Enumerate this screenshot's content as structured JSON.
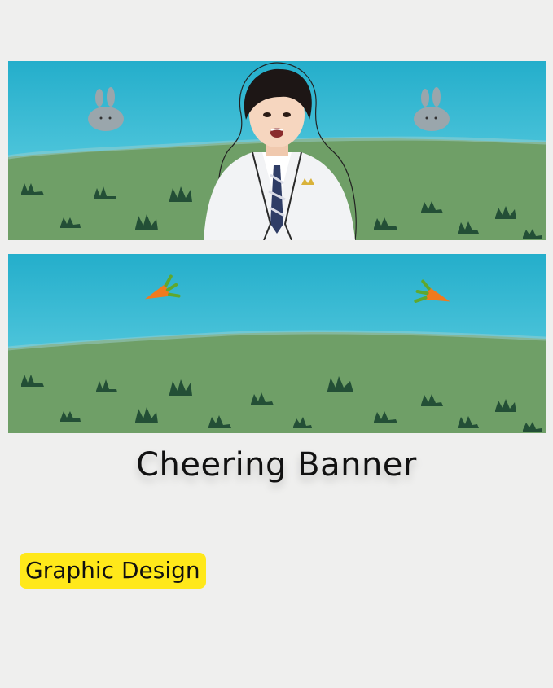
{
  "title": "Cheering Banner",
  "tag": "Graphic Design",
  "colors": {
    "page_bg": "#efefee",
    "sky": "#2fb6d2",
    "grass": "#6f9f67",
    "grass_tuft": "#234f36",
    "tag_bg": "#ffe81a"
  },
  "banners": [
    {
      "decorations": [
        "bunny-icon",
        "bunny-icon"
      ],
      "has_photo": true
    },
    {
      "decorations": [
        "carrot-icon",
        "carrot-icon"
      ],
      "has_photo": false
    }
  ]
}
